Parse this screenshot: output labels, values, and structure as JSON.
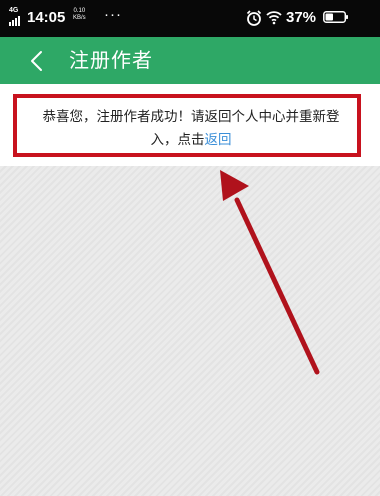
{
  "status_bar": {
    "network": "4G",
    "time": "14:05",
    "speed_value": "0.10",
    "speed_unit": "KB/s",
    "more": "···",
    "battery": "37%"
  },
  "header": {
    "title": "注册作者",
    "background": "#2ea866"
  },
  "message": {
    "text_line1": "恭喜您，注册作者成功！请返回个人中心并重新登",
    "text_line2": "入，点击",
    "link": "返回",
    "link_color": "#3b8fd8"
  },
  "annotation": {
    "color": "#c8121e"
  }
}
